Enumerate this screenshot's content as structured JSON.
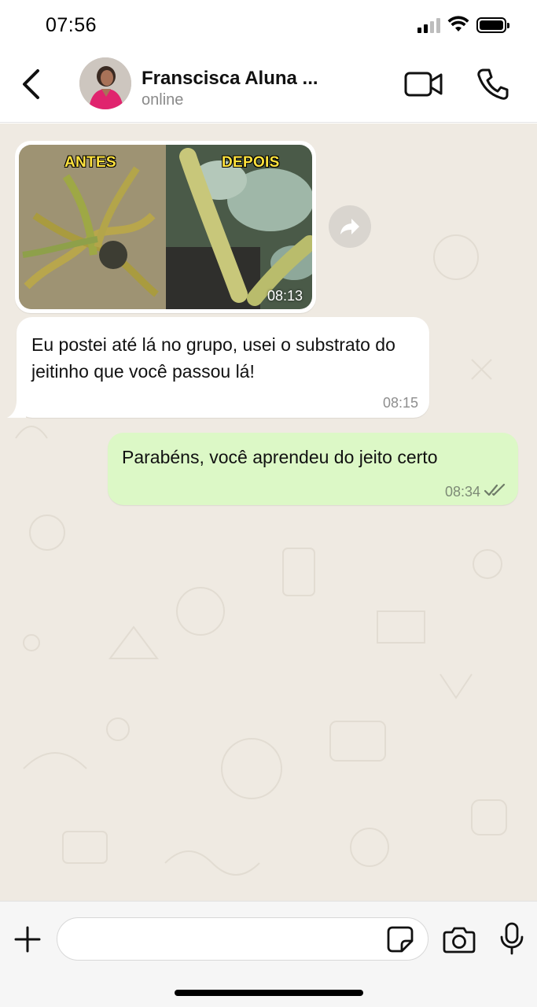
{
  "status_bar": {
    "time": "07:56",
    "icons": [
      "signal-icon",
      "wifi-icon",
      "battery-icon"
    ]
  },
  "header": {
    "contact_name": "Franscisca Aluna ...",
    "contact_status": "online",
    "icons": [
      "back-icon",
      "video-call-icon",
      "voice-call-icon"
    ]
  },
  "messages": [
    {
      "direction": "incoming",
      "type": "image",
      "labels": [
        "ANTES",
        "DEPOIS"
      ],
      "time": "08:13"
    },
    {
      "direction": "incoming",
      "type": "text",
      "text": "Eu postei até lá no grupo, usei o substrato do jeitinho que você passou lá!",
      "time": "08:15"
    },
    {
      "direction": "outgoing",
      "type": "text",
      "text": "Parabéns, você aprendeu do jeito certo",
      "time": "08:34",
      "status": "read"
    }
  ],
  "input_bar": {
    "placeholder": "",
    "icons": [
      "plus-icon",
      "sticker-icon",
      "camera-icon",
      "microphone-icon"
    ]
  },
  "colors": {
    "chat_background": "#efeae2",
    "outgoing_bubble": "#dcf8c6",
    "incoming_bubble": "#ffffff",
    "label_yellow": "#ffe23d"
  }
}
